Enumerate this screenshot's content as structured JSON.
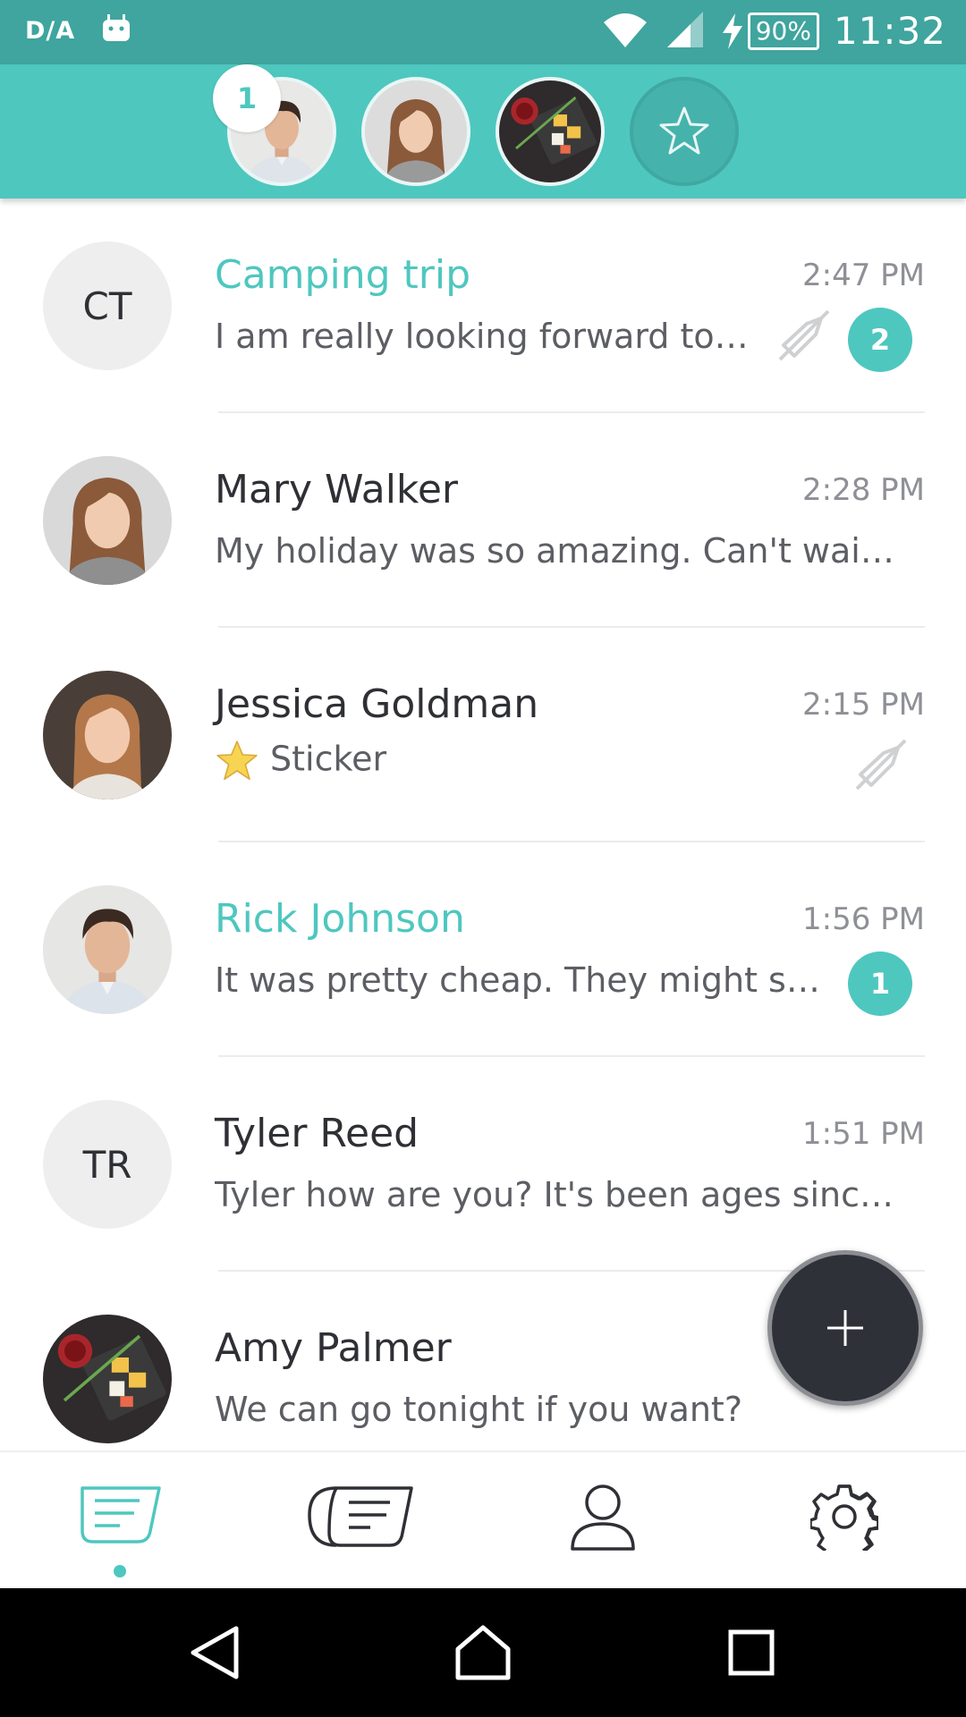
{
  "status_bar": {
    "carrier_logo": "D/A",
    "battery": "90%",
    "time": "11:32",
    "icons": [
      "android-icon",
      "wifi-icon",
      "signal-icon",
      "charging-icon",
      "battery-icon"
    ]
  },
  "favorites": {
    "badge_count": "1",
    "items": [
      {
        "name": "rick-johnson",
        "icon": "avatar-man"
      },
      {
        "name": "mary-walker",
        "icon": "avatar-woman"
      },
      {
        "name": "amy-palmer",
        "icon": "avatar-sushi"
      },
      {
        "name": "starred",
        "icon": "star-icon"
      }
    ]
  },
  "conversations": [
    {
      "initials": "CT",
      "name": "Camping trip",
      "time": "2:47 PM",
      "preview": "I am really looking forward to t...",
      "unread": "2",
      "muted": true
    },
    {
      "initials": "",
      "name": "Mary Walker",
      "time": "2:28 PM",
      "preview": "My holiday was so amazing. Can't wait...",
      "unread": "",
      "muted": false
    },
    {
      "initials": "",
      "name": "Jessica Goldman",
      "time": "2:15 PM",
      "preview": "Sticker",
      "unread": "",
      "muted": true
    },
    {
      "initials": "",
      "name": "Rick Johnson",
      "time": "1:56 PM",
      "preview": "It was pretty cheap. They might stil...",
      "unread": "1",
      "muted": false
    },
    {
      "initials": "TR",
      "name": "Tyler Reed",
      "time": "1:51 PM",
      "preview": "Tyler how are you? It's been ages since...",
      "unread": "",
      "muted": false
    },
    {
      "initials": "",
      "name": "Amy Palmer",
      "time": "",
      "preview": "We can go tonight if you want?",
      "unread": "",
      "muted": false
    }
  ],
  "bottom_nav": [
    "chats-icon",
    "group-chats-icon",
    "contacts-icon",
    "settings-icon"
  ],
  "system_nav": [
    "back-icon",
    "home-icon",
    "recents-icon"
  ],
  "colors": {
    "accent": "#4ec7bf",
    "status_bar": "#3fa59e",
    "fab": "#2e3138"
  }
}
